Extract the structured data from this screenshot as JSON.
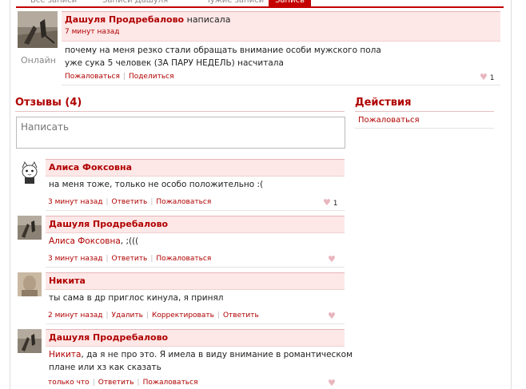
{
  "tabs": [
    "Все записи",
    "Записи Дашуля",
    "Чужие записи",
    "Запись"
  ],
  "post": {
    "author": "Дашуля Продребалово",
    "verb": "написала",
    "time": "7 минут назад",
    "status": "Онлайн",
    "text_lines": [
      "почему на меня резко стали обращать внимание особи мужского пола",
      "уже сука 5 человек (ЗА ПАРУ НЕДЕЛЬ) насчитала"
    ],
    "actions": [
      "Пожаловаться",
      "Поделиться"
    ],
    "likes": "1"
  },
  "reviews": {
    "title": "Отзывы (4)",
    "placeholder": "Написать",
    "items": [
      {
        "author": "Алиса Фоксовна",
        "text_lines": [
          "на меня тоже, только не особо положительно :("
        ],
        "meta": [
          "3 минут назад",
          "Ответить",
          "Пожаловаться"
        ],
        "likes": "1"
      },
      {
        "author": "Дашуля Продребалово",
        "mention": "Алиса Фоксовна",
        "text_lines": [
          ", ;((("
        ],
        "meta": [
          "3 минут назад",
          "Ответить",
          "Пожаловаться"
        ],
        "likes": ""
      },
      {
        "author": "Никита",
        "text_lines": [
          "ты сама в др приглос кинула, я принял"
        ],
        "meta": [
          "2 минут назад",
          "Удалить",
          "Корректировать",
          "Ответить"
        ],
        "likes": ""
      },
      {
        "author": "Дашуля Продребалово",
        "mention": "Никита",
        "text_lines": [
          ", да я не про это. Я имела в виду внимание в романтическом",
          "плане или хз как сказать"
        ],
        "meta": [
          "только что",
          "Ответить",
          "Пожаловаться"
        ],
        "likes": ""
      }
    ]
  },
  "actions_panel": {
    "title": "Действия",
    "items": [
      "Пожаловаться"
    ]
  },
  "colors": {
    "accent": "#b00000",
    "header_bg": "#fde7e7"
  }
}
